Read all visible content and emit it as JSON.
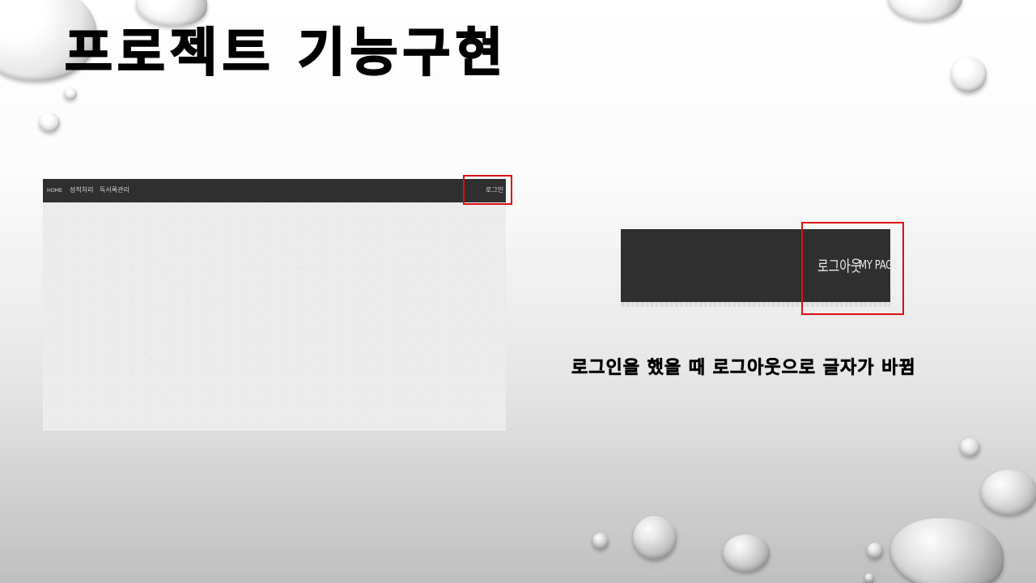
{
  "slide": {
    "title": "프로젝트 기능구현",
    "caption": "로그인을 했을 때 로그아웃으로 글자가 바뀜"
  },
  "site_nav": {
    "home": "HOME",
    "grades": "성적처리",
    "reading_log": "독서록관리",
    "login": "로그인"
  },
  "logged_in_nav": {
    "logout": "로그아웃",
    "my_page": "MY PAGE"
  },
  "colors": {
    "nav_background": "#2f2f2f",
    "highlight": "#e01010",
    "title_text": "#000000"
  }
}
